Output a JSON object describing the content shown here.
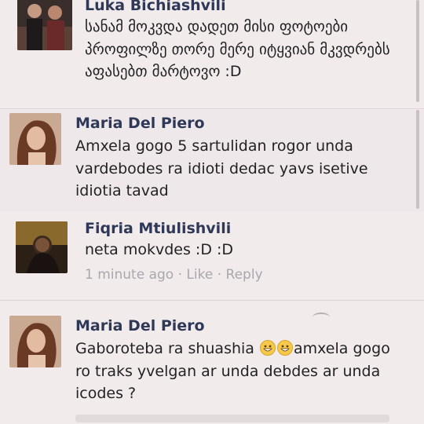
{
  "comments": [
    {
      "name": "Luka Bichiashvili",
      "text": "სანამ მოკვდა დადეთ მისი ფოტოები პროფილზე თორე მერე იტყვიან მკვდრებს აფასებთ მარტოვო :D"
    },
    {
      "name": "Maria Del Piero",
      "text": "Amxela gogo 5 sartulidan rogor unda vardebodes ra idioti dedac yavs isetive idiotia tavad"
    },
    {
      "name": "Fiqria Mtiulishvili",
      "text": "neta mokvdes :D :D",
      "time": "1 minute ago",
      "sep1": " · ",
      "like": "Like",
      "sep2": " · ",
      "reply": "Reply"
    },
    {
      "name": "Maria Del Piero",
      "text_before": "Gaboroteba ra shuashia ",
      "emoji": "grinning-face-emoji",
      "text_after": "amxela gogo ro traks yvelgan ar unda debdes ar unda icodes ?"
    }
  ],
  "colors": {
    "name": "#2f3957",
    "meta": "#a8a7ae",
    "background": "#f1ebec"
  }
}
